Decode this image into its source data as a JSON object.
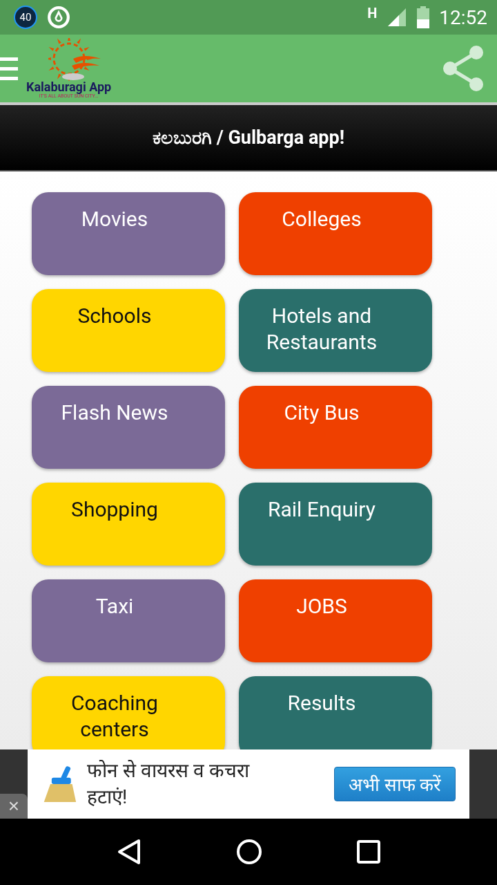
{
  "status_bar": {
    "notification_badge": "40",
    "network": "H",
    "time": "12:52"
  },
  "app_bar": {
    "logo_title": "Kalaburagi App",
    "logo_tagline": "IT'S ALL ABOUT SUN CITY..."
  },
  "title": "ಕಲಬುರಗಿ / Gulbarga app!",
  "tiles": [
    {
      "label": "Movies",
      "color": "#7b6a97"
    },
    {
      "label": "Colleges",
      "color": "#ef4000"
    },
    {
      "label": "Schools",
      "color": "#ffd600"
    },
    {
      "label": "Hotels and Restaurants",
      "color": "#2a6f6b"
    },
    {
      "label": "Flash News",
      "color": "#7b6a97"
    },
    {
      "label": "City Bus",
      "color": "#ef4000"
    },
    {
      "label": "Shopping",
      "color": "#ffd600"
    },
    {
      "label": "Rail Enquiry",
      "color": "#2a6f6b"
    },
    {
      "label": "Taxi",
      "color": "#7b6a97"
    },
    {
      "label": "JOBS",
      "color": "#ef4000"
    },
    {
      "label": "Coaching centers",
      "color": "#ffd600"
    },
    {
      "label": "Results",
      "color": "#2a6f6b"
    }
  ],
  "ad": {
    "text": "फोन से वायरस व कचरा हटाएं!",
    "button": "अभी साफ करें",
    "close": "×"
  }
}
